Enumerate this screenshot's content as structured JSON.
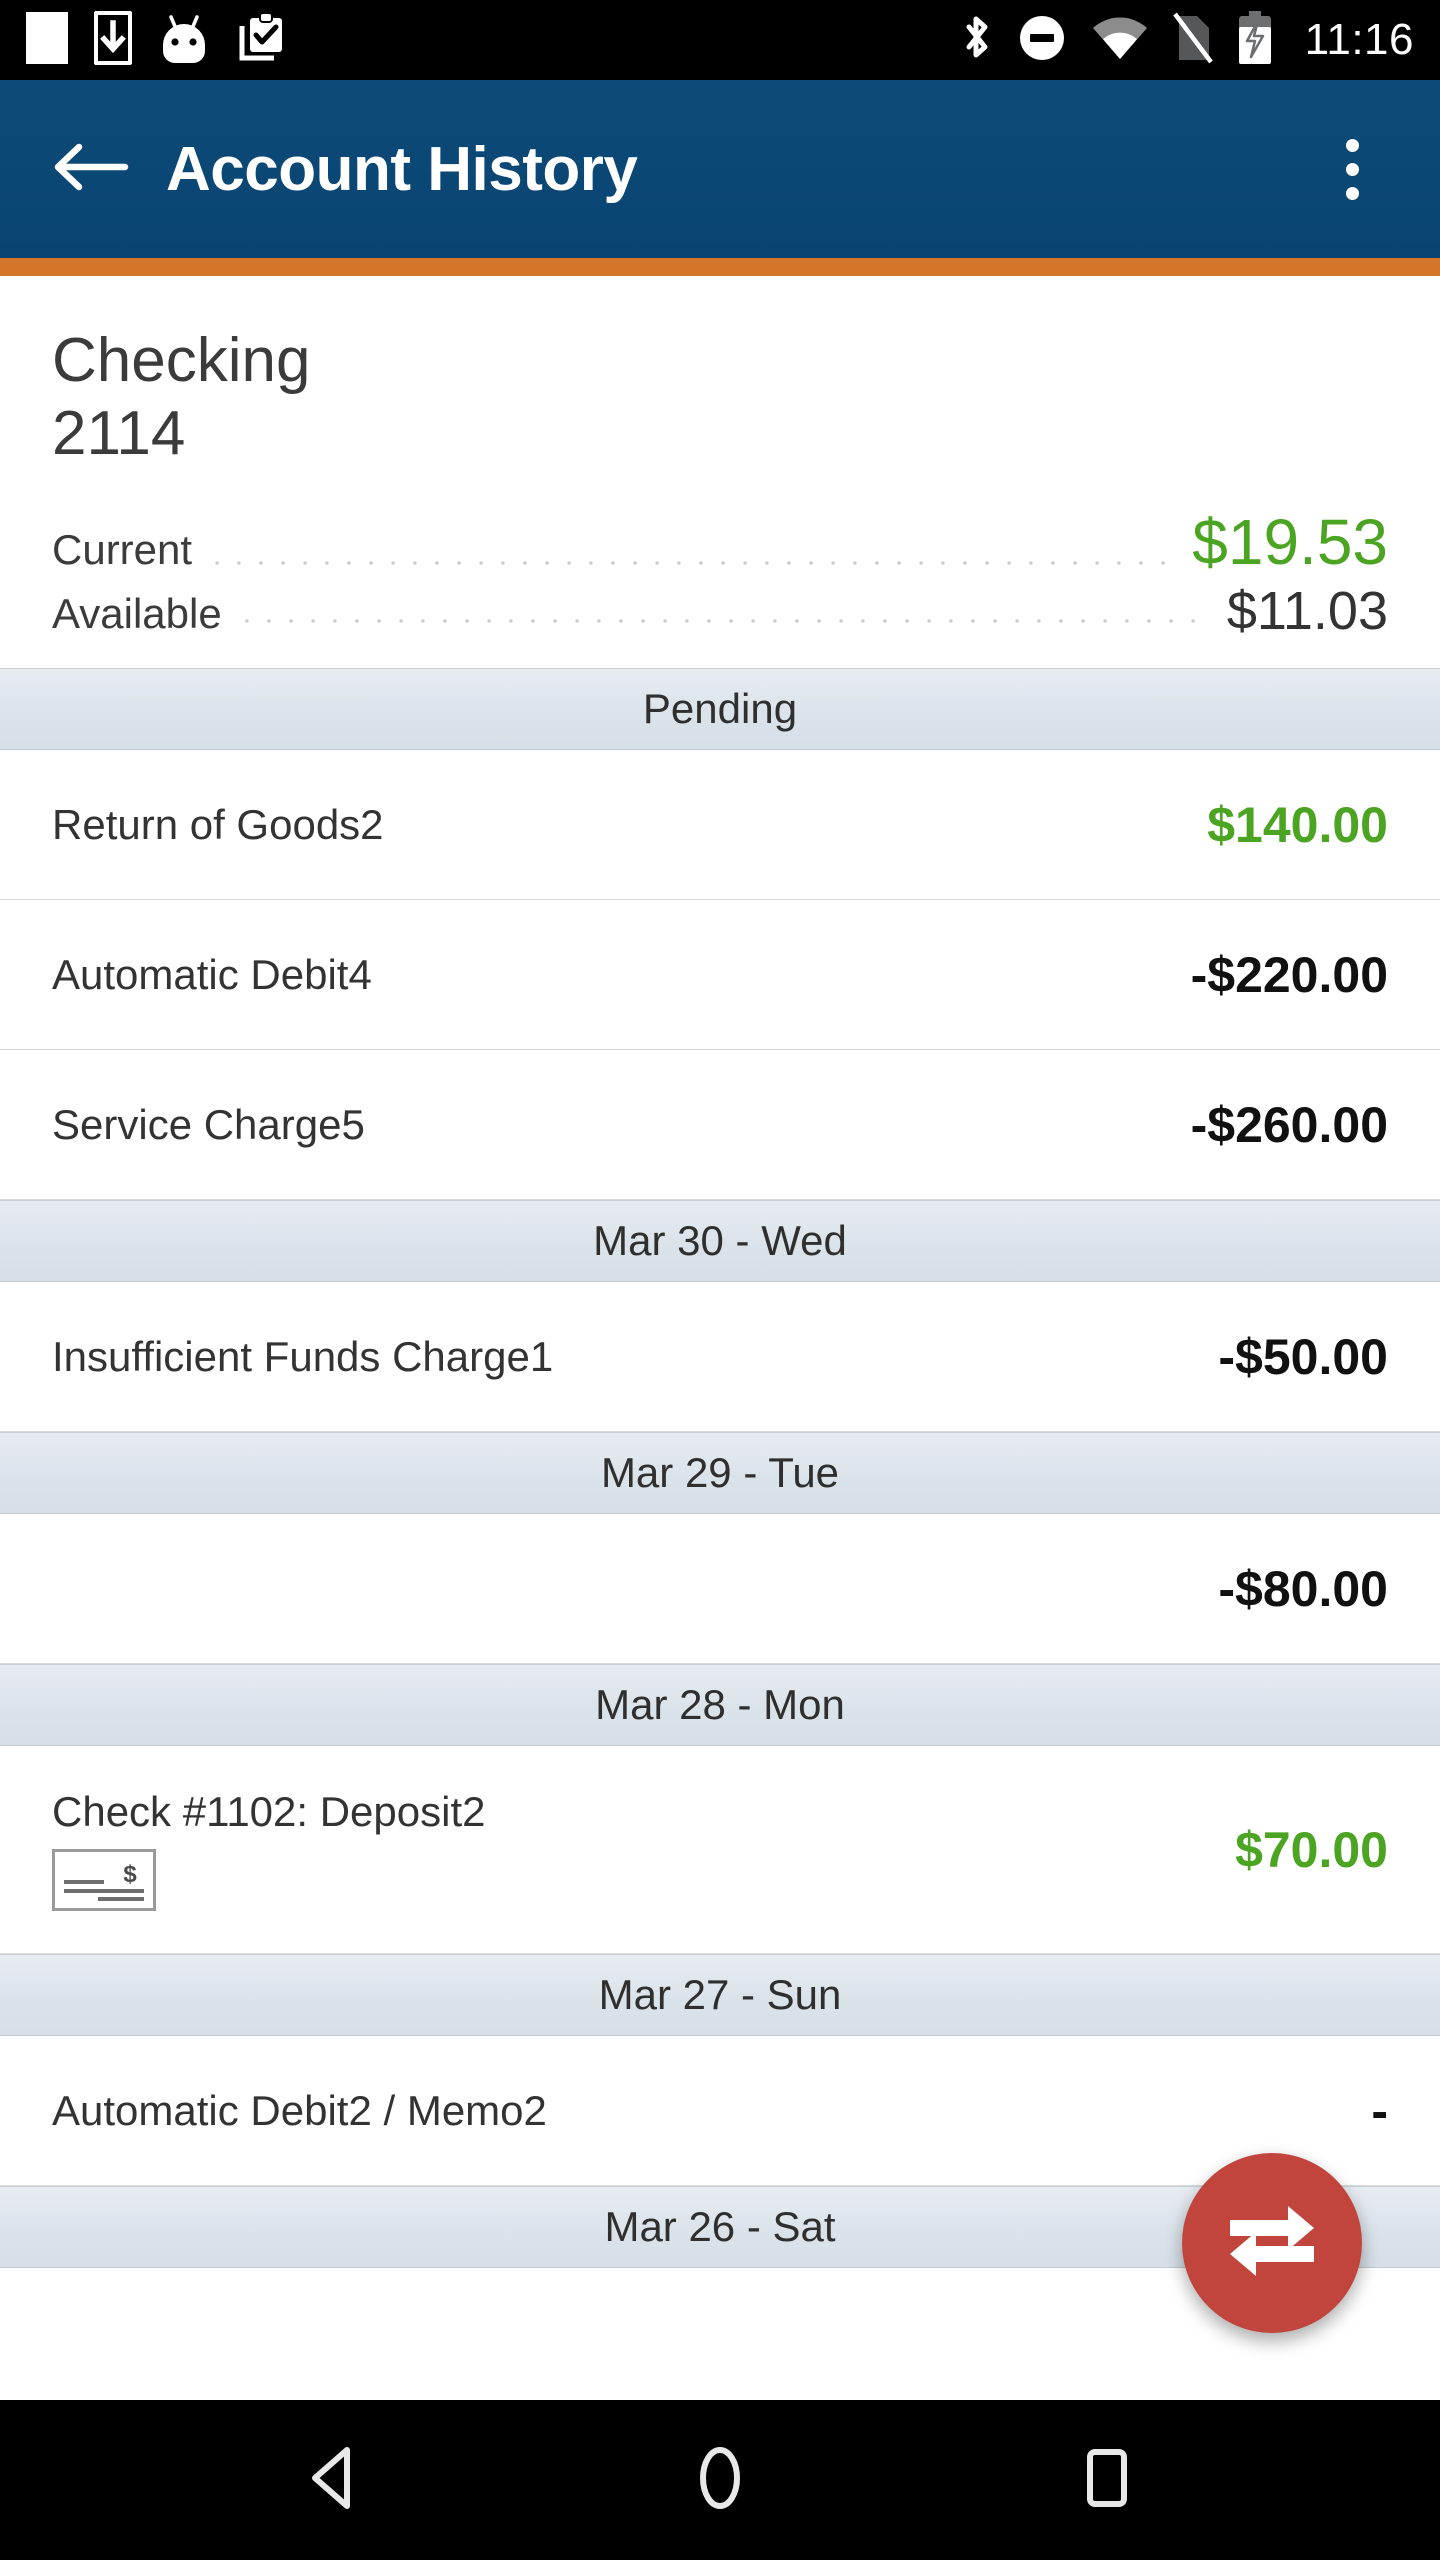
{
  "status_bar": {
    "time": "11:16",
    "left_icons": [
      "blank-notification-icon",
      "download-to-phone-icon",
      "android-robot-icon",
      "clipboard-check-icon"
    ],
    "right_icons": [
      "bluetooth-icon",
      "do-not-disturb-icon",
      "wifi-icon",
      "no-sim-icon",
      "battery-charging-icon"
    ]
  },
  "app_bar": {
    "title": "Account History",
    "back_icon": "arrow-left-icon",
    "overflow_icon": "more-vertical-icon",
    "background_color": "#0c4b79",
    "accent_color": "#d4762a"
  },
  "account": {
    "name": "Checking",
    "number": "2114",
    "balances": [
      {
        "label": "Current",
        "amount": "$19.53",
        "style": "positive"
      },
      {
        "label": "Available",
        "amount": "$11.03",
        "style": "neutral"
      }
    ]
  },
  "sections": [
    {
      "header": "Pending",
      "transactions": [
        {
          "description": "Return of Goods2",
          "amount": "$140.00",
          "style": "positive",
          "icon": null
        },
        {
          "description": "Automatic Debit4",
          "amount": "-$220.00",
          "style": "negative",
          "icon": null
        },
        {
          "description": "Service Charge5",
          "amount": "-$260.00",
          "style": "negative",
          "icon": null
        }
      ]
    },
    {
      "header": "Mar 30 - Wed",
      "transactions": [
        {
          "description": "Insufficient Funds Charge1",
          "amount": "-$50.00",
          "style": "negative",
          "icon": null
        }
      ]
    },
    {
      "header": "Mar 29 - Tue",
      "transactions": [
        {
          "description": "",
          "amount": "-$80.00",
          "style": "negative",
          "icon": null
        }
      ]
    },
    {
      "header": "Mar 28 - Mon",
      "transactions": [
        {
          "description": "Check #1102: Deposit2",
          "amount": "$70.00",
          "style": "positive",
          "icon": "check-image-icon"
        }
      ]
    },
    {
      "header": "Mar 27 - Sun",
      "transactions": [
        {
          "description": "Automatic Debit2 / Memo2",
          "amount": "-",
          "style": "negative",
          "icon": null
        }
      ]
    },
    {
      "header": "Mar 26 - Sat",
      "transactions": []
    }
  ],
  "fab": {
    "icon": "transfer-arrows-icon",
    "color": "#c2453d"
  },
  "nav_bar": {
    "buttons": [
      "back-triangle-icon",
      "home-circle-icon",
      "recents-square-icon"
    ]
  },
  "colors": {
    "positive_green": "#4ca423",
    "negative_black": "#111111",
    "section_header_bg": "#dbe3ea"
  }
}
